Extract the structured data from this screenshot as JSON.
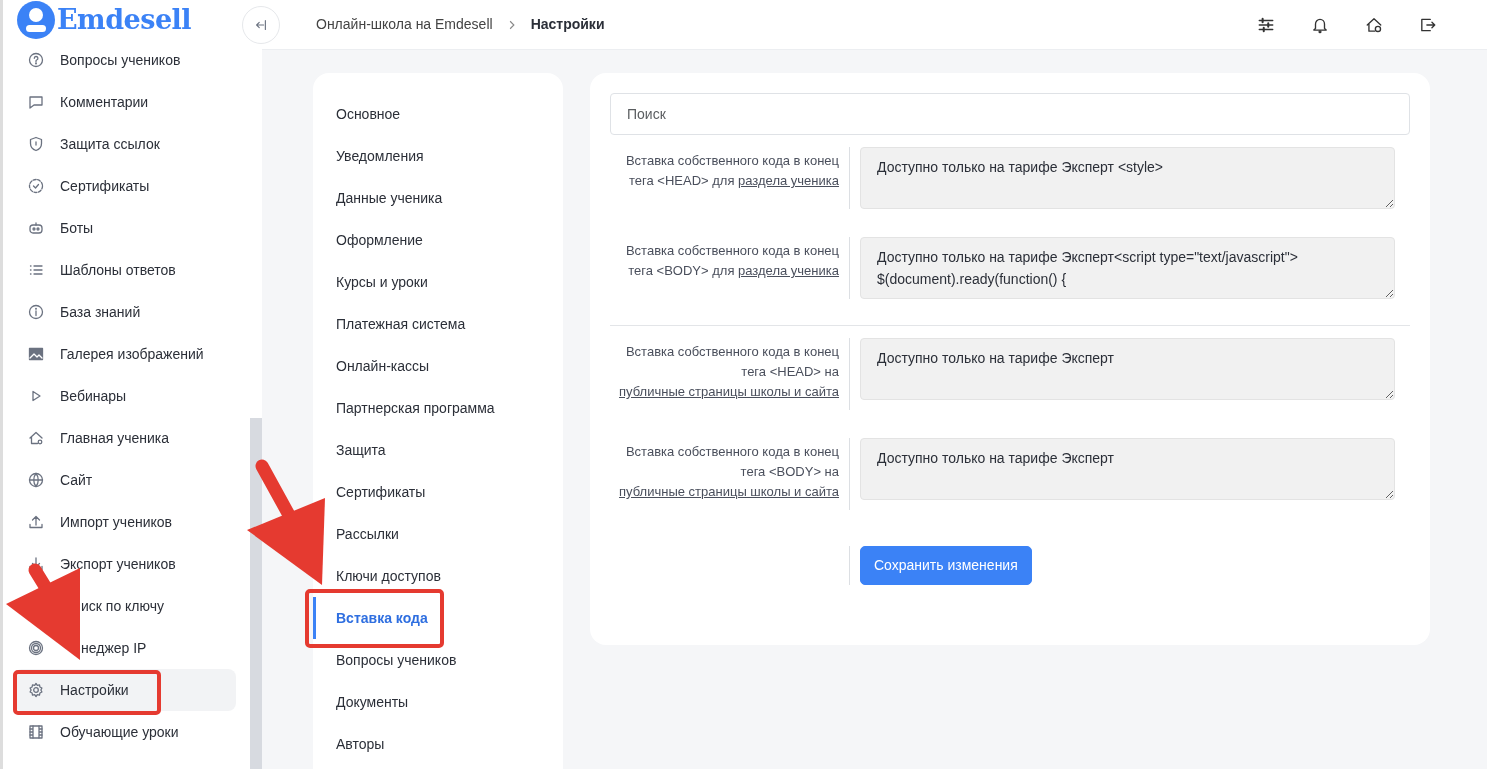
{
  "logo": {
    "text": "Emdesell"
  },
  "sidebar": {
    "items": [
      {
        "label": "Вопросы учеников",
        "selected": false
      },
      {
        "label": "Комментарии",
        "selected": false
      },
      {
        "label": "Защита ссылок",
        "selected": false
      },
      {
        "label": "Сертификаты",
        "selected": false
      },
      {
        "label": "Боты",
        "selected": false
      },
      {
        "label": "Шаблоны ответов",
        "selected": false
      },
      {
        "label": "База знаний",
        "selected": false
      },
      {
        "label": "Галерея изображений",
        "selected": false
      },
      {
        "label": "Вебинары",
        "selected": false
      },
      {
        "label": "Главная ученика",
        "selected": false
      },
      {
        "label": "Сайт",
        "selected": false
      },
      {
        "label": "Импорт учеников",
        "selected": false
      },
      {
        "label": "Экспорт учеников",
        "selected": false
      },
      {
        "label": "иск по ключу",
        "selected": false,
        "kind": "clipped"
      },
      {
        "label": "неджер IP",
        "selected": false,
        "kind": "clipped"
      },
      {
        "label": "Настройки",
        "selected": true
      },
      {
        "label": "Обучающие уроки",
        "selected": false
      }
    ]
  },
  "breadcrumb": [
    "Онлайн-школа на Emdesell",
    "Настройки"
  ],
  "settings_menu": {
    "items": [
      {
        "label": "Основное",
        "selected": false
      },
      {
        "label": "Уведомления",
        "selected": false
      },
      {
        "label": "Данные ученика",
        "selected": false
      },
      {
        "label": "Оформление",
        "selected": false
      },
      {
        "label": "Курсы и уроки",
        "selected": false
      },
      {
        "label": "Платежная система",
        "selected": false
      },
      {
        "label": "Онлайн-кассы",
        "selected": false
      },
      {
        "label": "Партнерская программа",
        "selected": false
      },
      {
        "label": "Защита",
        "selected": false
      },
      {
        "label": "Сертификаты",
        "selected": false
      },
      {
        "label": "Рассылки",
        "selected": false
      },
      {
        "label": "Ключи доступов",
        "selected": false
      },
      {
        "label": "Вставка кода",
        "selected": true
      },
      {
        "label": "Вопросы учеников",
        "selected": false
      },
      {
        "label": "Документы",
        "selected": false
      },
      {
        "label": "Авторы",
        "selected": false
      }
    ]
  },
  "search": {
    "placeholder": "Поиск"
  },
  "groups": [
    {
      "fields": [
        {
          "label": "Вставка собственного кода в конец тега <HEAD> для",
          "link": "раздела ученика",
          "value": "Доступно только на тарифе Эксперт <style>"
        },
        {
          "label": "Вставка собственного кода в конец тега <BODY> для",
          "link": "раздела ученика",
          "value": "Доступно только на тарифе Эксперт<script type=\"text/javascript\">\n$(document).ready(function() {"
        }
      ]
    },
    {
      "fields": [
        {
          "label": "Вставка собственного кода в конец тега <HEAD> на",
          "link": "публичные страницы школы и сайта",
          "value": "Доступно только на тарифе Эксперт"
        },
        {
          "label": "Вставка собственного кода в конец тега <BODY> на",
          "link": "публичные страницы школы и сайта",
          "value": "Доступно только на тарифе Эксперт"
        }
      ]
    }
  ],
  "save_button": {
    "label": "Сохранить изменения"
  }
}
